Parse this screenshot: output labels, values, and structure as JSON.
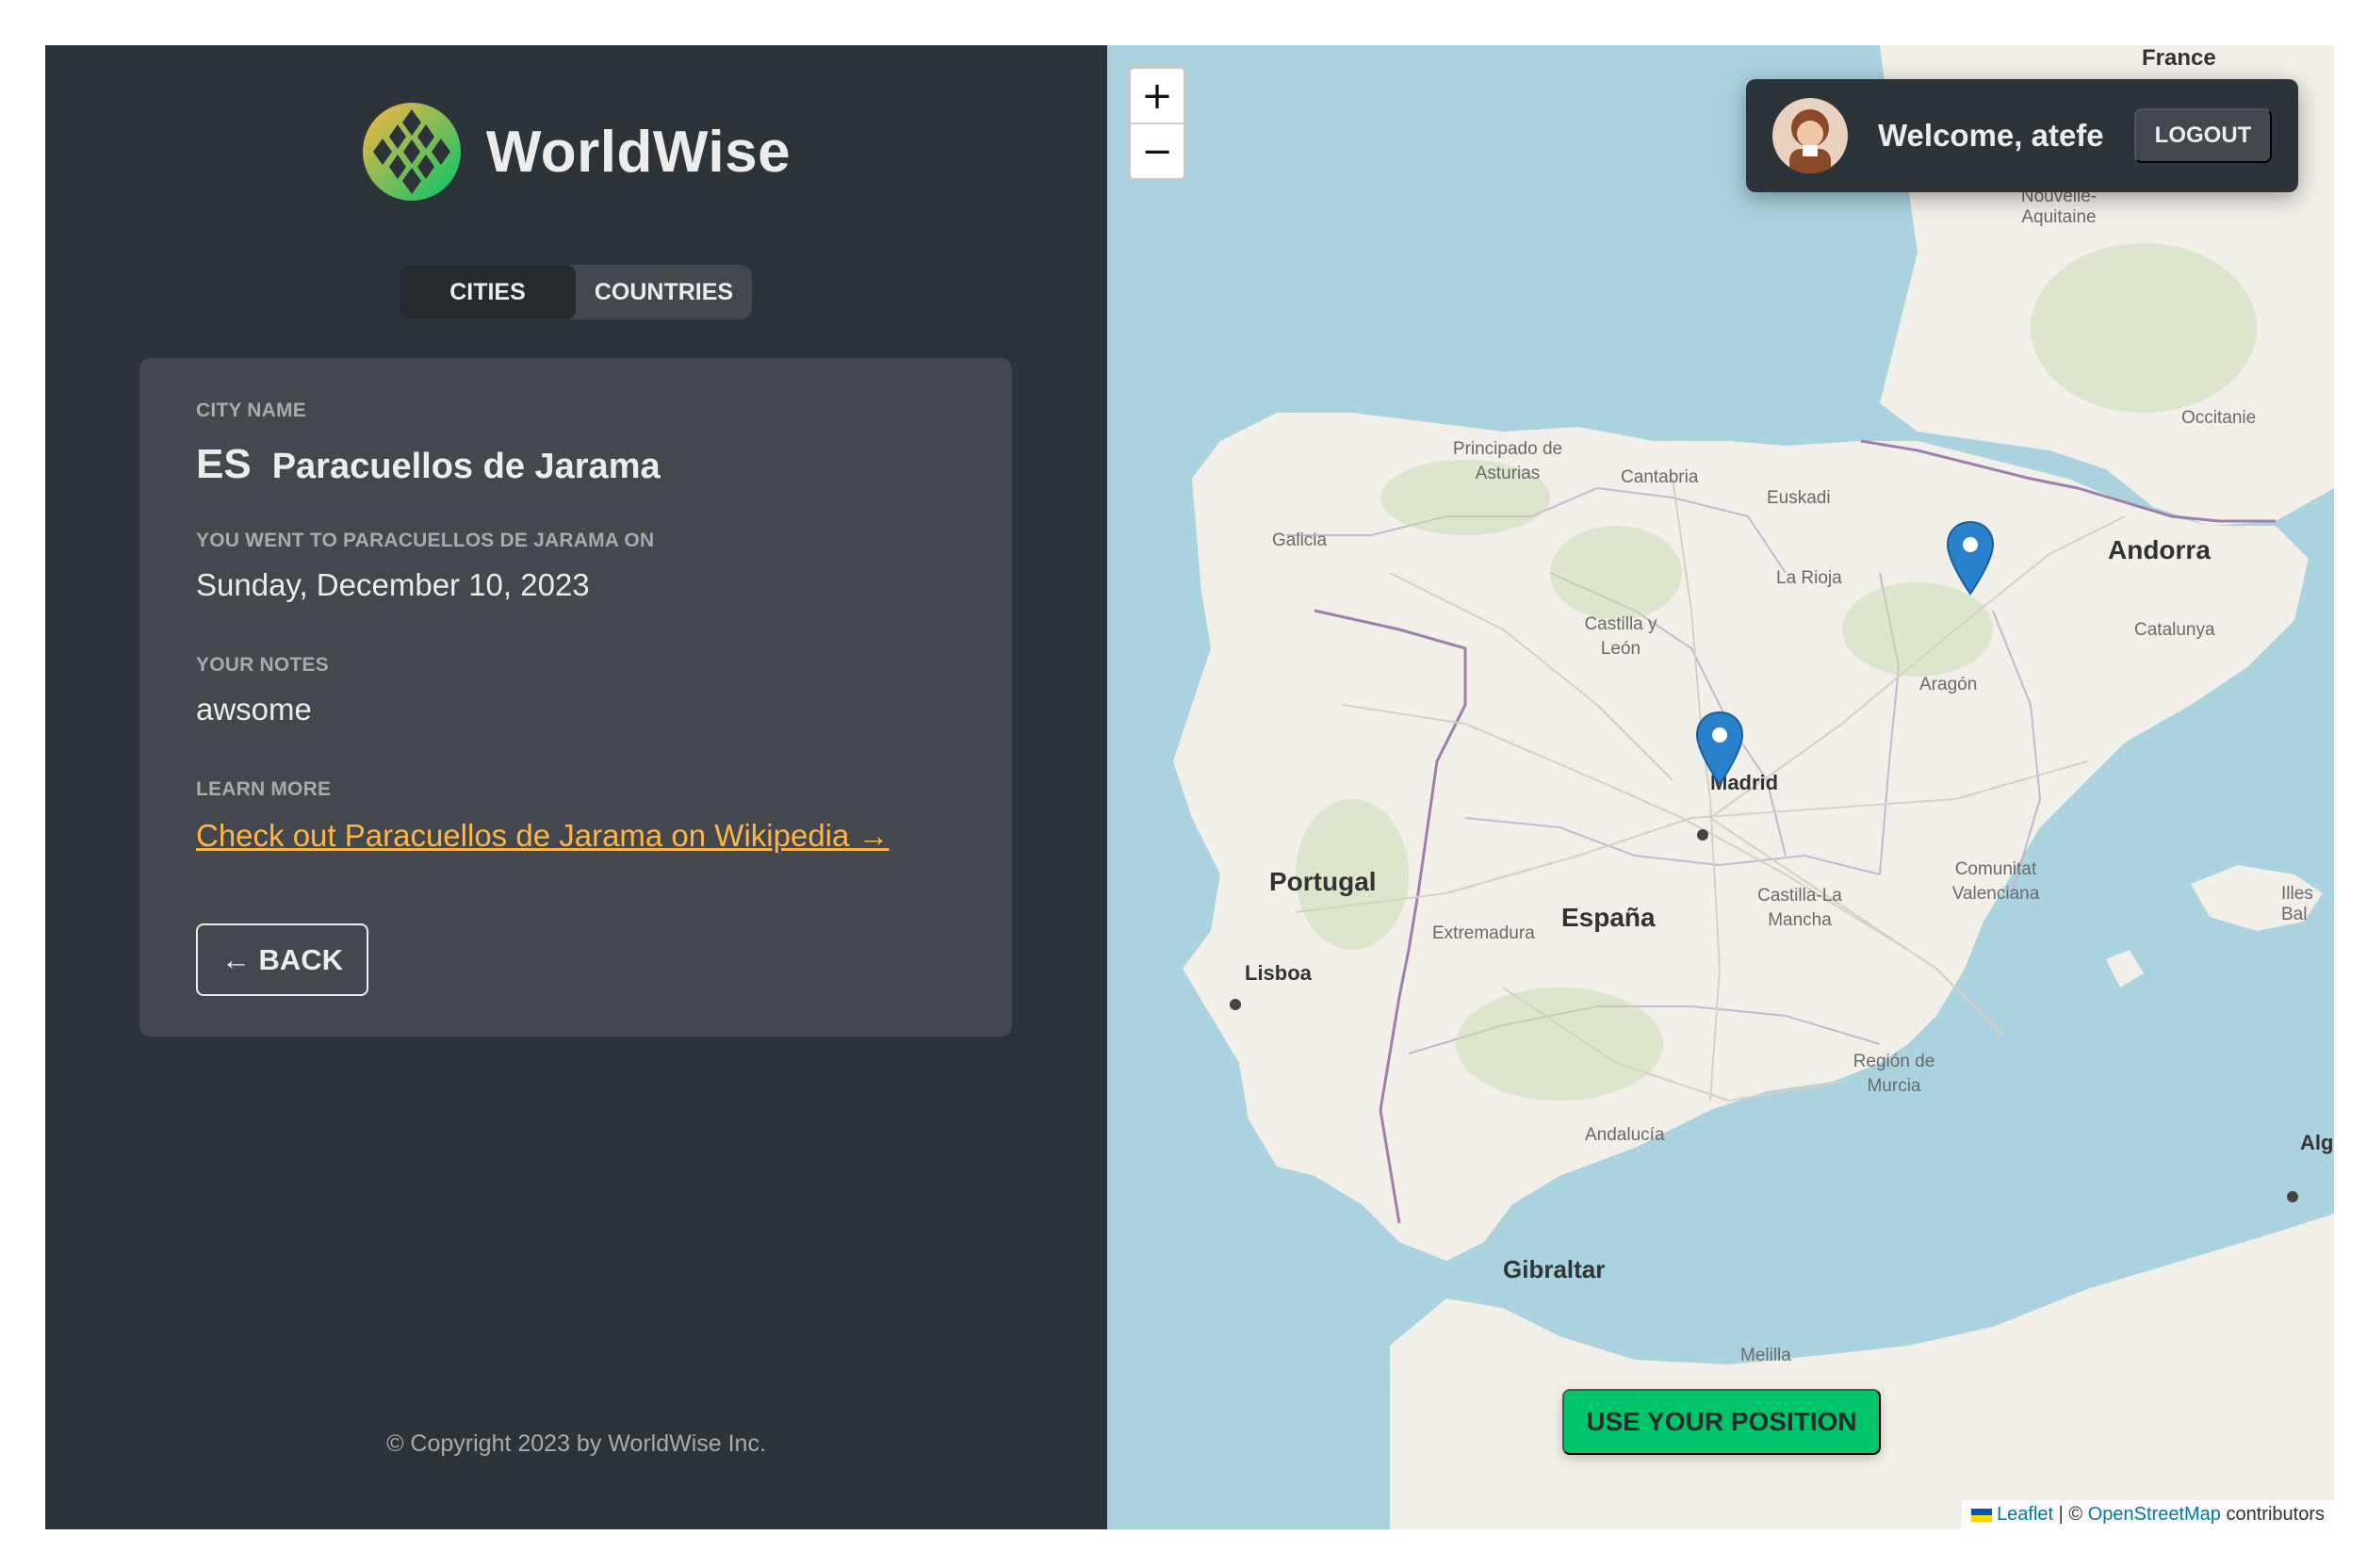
{
  "app": {
    "name": "WorldWise"
  },
  "tabs": [
    {
      "label": "CITIES",
      "active": true
    },
    {
      "label": "COUNTRIES",
      "active": false
    }
  ],
  "city": {
    "name_label": "CITY NAME",
    "flag": "ES",
    "name": "Paracuellos de Jarama",
    "visited_label": "YOU WENT TO PARACUELLOS DE JARAMA ON",
    "visited_date": "Sunday, December 10, 2023",
    "notes_label": "YOUR NOTES",
    "notes": "awsome",
    "learn_label": "LEARN MORE",
    "wiki_link": "Check out Paracuellos de Jarama on Wikipedia →",
    "back_label": "← BACK"
  },
  "footer": {
    "copyright": "© Copyright 2023 by WorldWise Inc."
  },
  "map": {
    "zoom_in": "+",
    "zoom_out": "−",
    "user": {
      "welcome": "Welcome, atefe",
      "logout": "LOGOUT"
    },
    "geo_button": "USE YOUR POSITION",
    "attribution": {
      "leaflet": "Leaflet",
      "separator": " | © ",
      "osm": "OpenStreetMap",
      "suffix": " contributors"
    },
    "labels": {
      "france": "France",
      "nouvelle_aquitaine": "Nouvelle-Aquitaine",
      "occitanie": "Occitanie",
      "principado": "Principado de Asturias",
      "cantabria": "Cantabria",
      "euskadi": "Euskadi",
      "galicia": "Galicia",
      "la_rioja": "La Rioja",
      "andorra": "Andorra",
      "catalunya": "Catalunya",
      "castilla_leon": "Castilla y León",
      "aragon": "Aragón",
      "madrid": "Madrid",
      "portugal": "Portugal",
      "castilla_mancha": "Castilla-La Mancha",
      "comunitat": "Comunitat Valenciana",
      "illes_balears": "Illes Bal",
      "espana": "España",
      "extremadura": "Extremadura",
      "lisboa": "Lisboa",
      "region_murcia": "Región de Murcia",
      "andalucia": "Andalucía",
      "alg": "Alg",
      "gibraltar": "Gibraltar",
      "melilla": "Melilla"
    },
    "markers": [
      "Paracuellos de Jarama",
      "Aragón"
    ]
  },
  "colors": {
    "sidebar_bg": "#2d3439",
    "card_bg": "#42484d",
    "accent_link": "#ffb545",
    "geo_button": "#00c46a",
    "sea": "#aad3df",
    "land": "#f2efe9",
    "marker": "#2a81cb"
  }
}
